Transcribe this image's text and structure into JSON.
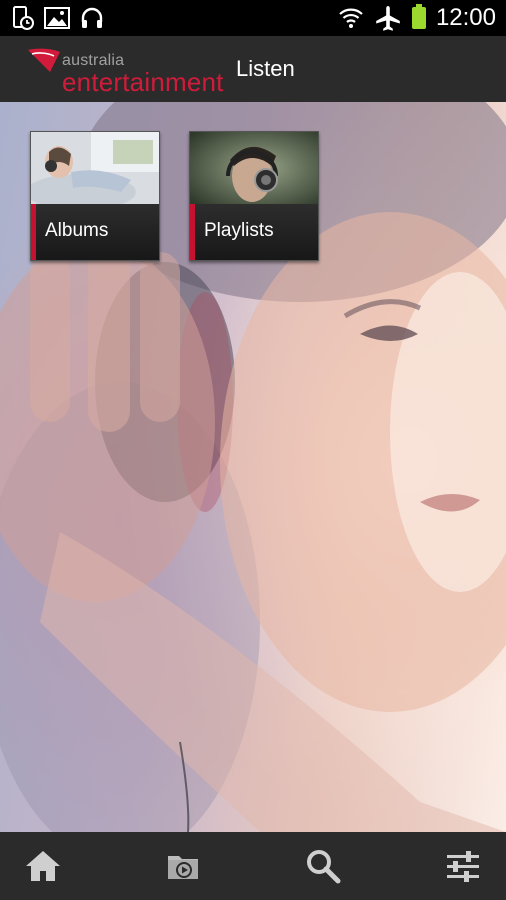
{
  "status_bar": {
    "time": "12:00",
    "left_icons": [
      "phone-status-icon",
      "image-icon",
      "headphones-icon"
    ],
    "right_icons": [
      "wifi-icon",
      "airplane-mode-icon",
      "battery-icon"
    ]
  },
  "header": {
    "logo_line1": "australia",
    "logo_line2": "entertainment",
    "logo_badge": "Virgin",
    "title": "Listen"
  },
  "tiles": [
    {
      "label": "Albums",
      "icon": "albums-thumbnail"
    },
    {
      "label": "Playlists",
      "icon": "playlists-thumbnail"
    }
  ],
  "bottom_nav": {
    "items": [
      "home-icon",
      "media-folder-icon",
      "search-icon",
      "settings-sliders-icon"
    ]
  },
  "colors": {
    "brand_red": "#d01c3a",
    "accent_red": "#c41230",
    "header_bg": "#2b2b2b",
    "battery_green": "#9bd92f"
  }
}
